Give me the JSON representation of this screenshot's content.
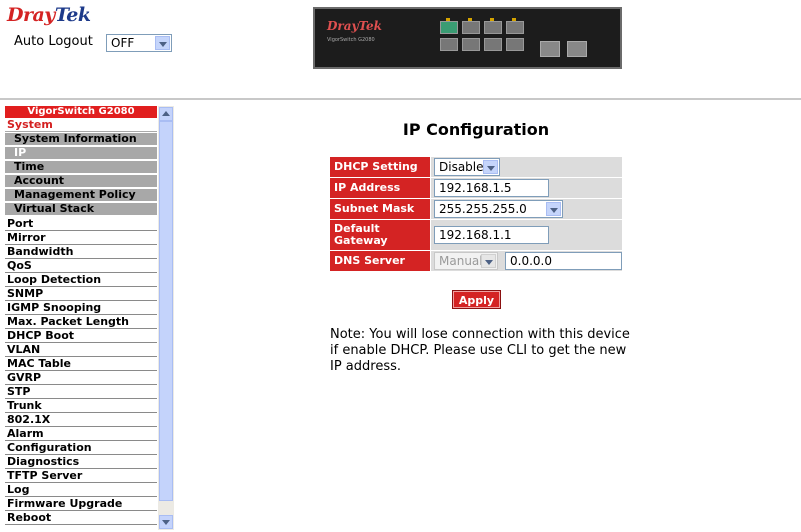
{
  "brand": {
    "dray": "Dray",
    "tek": "Tek"
  },
  "header": {
    "auto_logout_label": "Auto Logout",
    "auto_logout_value": "OFF",
    "device": {
      "brand": "DrayTek",
      "model": "VigorSwitch G2080"
    }
  },
  "sidebar": {
    "header": "VigorSwitch G2080",
    "system_label": "System",
    "system_items": [
      {
        "label": "System Information",
        "active": false
      },
      {
        "label": "IP",
        "active": true
      },
      {
        "label": "Time",
        "active": false
      },
      {
        "label": "Account",
        "active": false
      },
      {
        "label": "Management Policy",
        "active": false
      },
      {
        "label": "Virtual Stack",
        "active": false
      }
    ],
    "items": [
      "Port",
      "Mirror",
      "Bandwidth",
      "QoS",
      "Loop Detection",
      "SNMP",
      "IGMP Snooping",
      "Max. Packet Length",
      "DHCP Boot",
      "VLAN",
      "MAC Table",
      "GVRP",
      "STP",
      "Trunk",
      "802.1X",
      "Alarm",
      "Configuration",
      "Diagnostics",
      "TFTP Server",
      "Log",
      "Firmware Upgrade",
      "Reboot"
    ]
  },
  "main": {
    "title": "IP Configuration",
    "fields": {
      "dhcp_label": "DHCP Setting",
      "dhcp_value": "Disable",
      "ip_label": "IP Address",
      "ip_value": "192.168.1.5",
      "subnet_label": "Subnet Mask",
      "subnet_value": "255.255.255.0",
      "gateway_label": "Default Gateway",
      "gateway_value": "192.168.1.1",
      "dns_label": "DNS Server",
      "dns_mode": "Manual",
      "dns_value": "0.0.0.0"
    },
    "apply_label": "Apply",
    "note": "Note: You will lose connection with this device if enable DHCP. Please use CLI to get the new IP address."
  },
  "colors": {
    "accent_red": "#d42323",
    "sub_item_gray": "#a8a8a8",
    "cell_gray": "#dcdcdc",
    "scroll_blue": "#c4d3fb"
  }
}
